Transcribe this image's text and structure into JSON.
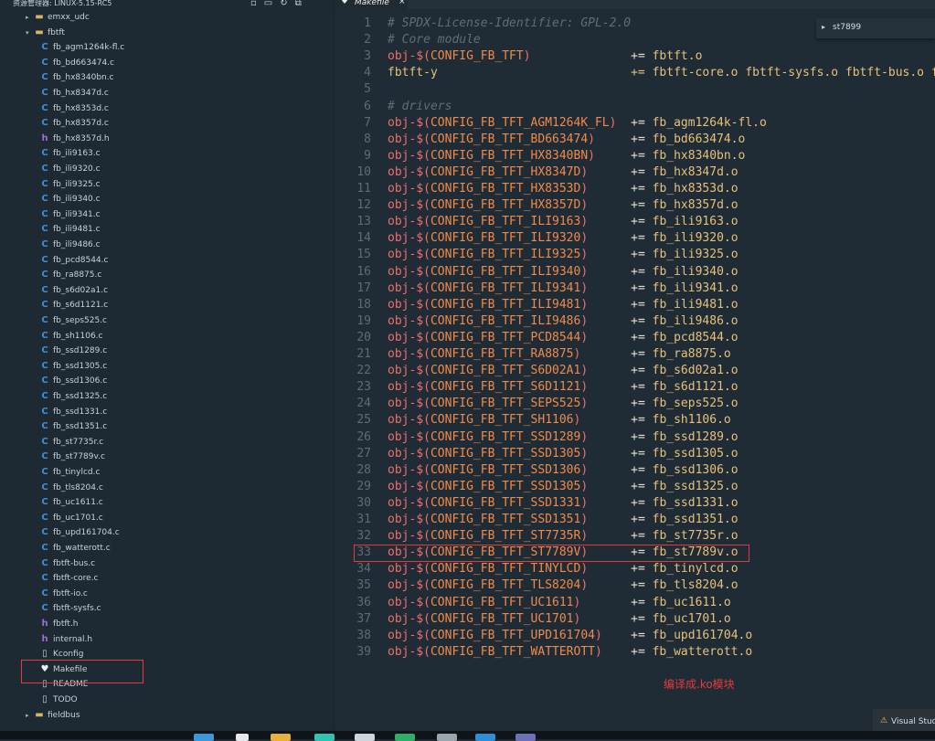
{
  "explorer": {
    "title": "资源管理器: LINUX-5.15-RC5",
    "items": [
      {
        "label": "emxx_udc",
        "type": "folder",
        "expanded": false
      },
      {
        "label": "fbtft",
        "type": "folder",
        "expanded": true
      },
      {
        "label": "fb_agm1264k-fl.c",
        "type": "c"
      },
      {
        "label": "fb_bd663474.c",
        "type": "c"
      },
      {
        "label": "fb_hx8340bn.c",
        "type": "c"
      },
      {
        "label": "fb_hx8347d.c",
        "type": "c"
      },
      {
        "label": "fb_hx8353d.c",
        "type": "c"
      },
      {
        "label": "fb_hx8357d.c",
        "type": "c"
      },
      {
        "label": "fb_hx8357d.h",
        "type": "h"
      },
      {
        "label": "fb_ili9163.c",
        "type": "c"
      },
      {
        "label": "fb_ili9320.c",
        "type": "c"
      },
      {
        "label": "fb_ili9325.c",
        "type": "c"
      },
      {
        "label": "fb_ili9340.c",
        "type": "c"
      },
      {
        "label": "fb_ili9341.c",
        "type": "c"
      },
      {
        "label": "fb_ili9481.c",
        "type": "c"
      },
      {
        "label": "fb_ili9486.c",
        "type": "c"
      },
      {
        "label": "fb_pcd8544.c",
        "type": "c"
      },
      {
        "label": "fb_ra8875.c",
        "type": "c"
      },
      {
        "label": "fb_s6d02a1.c",
        "type": "c"
      },
      {
        "label": "fb_s6d1121.c",
        "type": "c"
      },
      {
        "label": "fb_seps525.c",
        "type": "c"
      },
      {
        "label": "fb_sh1106.c",
        "type": "c"
      },
      {
        "label": "fb_ssd1289.c",
        "type": "c"
      },
      {
        "label": "fb_ssd1305.c",
        "type": "c"
      },
      {
        "label": "fb_ssd1306.c",
        "type": "c"
      },
      {
        "label": "fb_ssd1325.c",
        "type": "c"
      },
      {
        "label": "fb_ssd1331.c",
        "type": "c"
      },
      {
        "label": "fb_ssd1351.c",
        "type": "c"
      },
      {
        "label": "fb_st7735r.c",
        "type": "c"
      },
      {
        "label": "fb_st7789v.c",
        "type": "c"
      },
      {
        "label": "fb_tinylcd.c",
        "type": "c"
      },
      {
        "label": "fb_tls8204.c",
        "type": "c"
      },
      {
        "label": "fb_uc1611.c",
        "type": "c"
      },
      {
        "label": "fb_uc1701.c",
        "type": "c"
      },
      {
        "label": "fb_upd161704.c",
        "type": "c"
      },
      {
        "label": "fb_watterott.c",
        "type": "c"
      },
      {
        "label": "fbtft-bus.c",
        "type": "c"
      },
      {
        "label": "fbtft-core.c",
        "type": "c"
      },
      {
        "label": "fbtft-io.c",
        "type": "c"
      },
      {
        "label": "fbtft-sysfs.c",
        "type": "c"
      },
      {
        "label": "fbtft.h",
        "type": "h"
      },
      {
        "label": "internal.h",
        "type": "h"
      },
      {
        "label": "Kconfig",
        "type": "file"
      },
      {
        "label": "Makefile",
        "type": "make",
        "selected": true
      },
      {
        "label": "README",
        "type": "file"
      },
      {
        "label": "TODO",
        "type": "file"
      },
      {
        "label": "fieldbus",
        "type": "folder",
        "expanded": false
      }
    ]
  },
  "tab": {
    "label": "Makefile",
    "close": "×"
  },
  "find": {
    "query": "st7899"
  },
  "annotation": "编译成.ko模块",
  "notification": {
    "text": "Visual Stud"
  },
  "code": [
    {
      "n": "1",
      "kind": "comment",
      "text": "# SPDX-License-Identifier: GPL-2.0"
    },
    {
      "n": "2",
      "kind": "comment",
      "text": "# Core module"
    },
    {
      "n": "3",
      "kind": "obj",
      "macro": "CONFIG_FB_TFT",
      "pad": "            ",
      "val": "fbtft.o"
    },
    {
      "n": "4",
      "kind": "plain",
      "text": "fbtft-y                           += fbtft-core.o fbtft-sysfs.o fbtft-bus.o fbtft-io.o"
    },
    {
      "n": "5",
      "kind": "blank",
      "text": ""
    },
    {
      "n": "6",
      "kind": "comment",
      "text": "# drivers"
    },
    {
      "n": "7",
      "kind": "obj",
      "macro": "CONFIG_FB_TFT_AGM1264K_FL",
      "pad": "",
      "val": "fb_agm1264k-fl.o"
    },
    {
      "n": "8",
      "kind": "obj",
      "macro": "CONFIG_FB_TFT_BD663474",
      "pad": "   ",
      "val": "fb_bd663474.o"
    },
    {
      "n": "9",
      "kind": "obj",
      "macro": "CONFIG_FB_TFT_HX8340BN",
      "pad": "   ",
      "val": "fb_hx8340bn.o"
    },
    {
      "n": "10",
      "kind": "obj",
      "macro": "CONFIG_FB_TFT_HX8347D",
      "pad": "    ",
      "val": "fb_hx8347d.o"
    },
    {
      "n": "11",
      "kind": "obj",
      "macro": "CONFIG_FB_TFT_HX8353D",
      "pad": "    ",
      "val": "fb_hx8353d.o"
    },
    {
      "n": "12",
      "kind": "obj",
      "macro": "CONFIG_FB_TFT_HX8357D",
      "pad": "    ",
      "val": "fb_hx8357d.o"
    },
    {
      "n": "13",
      "kind": "obj",
      "macro": "CONFIG_FB_TFT_ILI9163",
      "pad": "    ",
      "val": "fb_ili9163.o"
    },
    {
      "n": "14",
      "kind": "obj",
      "macro": "CONFIG_FB_TFT_ILI9320",
      "pad": "    ",
      "val": "fb_ili9320.o"
    },
    {
      "n": "15",
      "kind": "obj",
      "macro": "CONFIG_FB_TFT_ILI9325",
      "pad": "    ",
      "val": "fb_ili9325.o"
    },
    {
      "n": "16",
      "kind": "obj",
      "macro": "CONFIG_FB_TFT_ILI9340",
      "pad": "    ",
      "val": "fb_ili9340.o"
    },
    {
      "n": "17",
      "kind": "obj",
      "macro": "CONFIG_FB_TFT_ILI9341",
      "pad": "    ",
      "val": "fb_ili9341.o"
    },
    {
      "n": "18",
      "kind": "obj",
      "macro": "CONFIG_FB_TFT_ILI9481",
      "pad": "    ",
      "val": "fb_ili9481.o"
    },
    {
      "n": "19",
      "kind": "obj",
      "macro": "CONFIG_FB_TFT_ILI9486",
      "pad": "    ",
      "val": "fb_ili9486.o"
    },
    {
      "n": "20",
      "kind": "obj",
      "macro": "CONFIG_FB_TFT_PCD8544",
      "pad": "    ",
      "val": "fb_pcd8544.o"
    },
    {
      "n": "21",
      "kind": "obj",
      "macro": "CONFIG_FB_TFT_RA8875",
      "pad": "     ",
      "val": "fb_ra8875.o"
    },
    {
      "n": "22",
      "kind": "obj",
      "macro": "CONFIG_FB_TFT_S6D02A1",
      "pad": "    ",
      "val": "fb_s6d02a1.o"
    },
    {
      "n": "23",
      "kind": "obj",
      "macro": "CONFIG_FB_TFT_S6D1121",
      "pad": "    ",
      "val": "fb_s6d1121.o"
    },
    {
      "n": "24",
      "kind": "obj",
      "macro": "CONFIG_FB_TFT_SEPS525",
      "pad": "    ",
      "val": "fb_seps525.o"
    },
    {
      "n": "25",
      "kind": "obj",
      "macro": "CONFIG_FB_TFT_SH1106",
      "pad": "     ",
      "val": "fb_sh1106.o"
    },
    {
      "n": "26",
      "kind": "obj",
      "macro": "CONFIG_FB_TFT_SSD1289",
      "pad": "    ",
      "val": "fb_ssd1289.o"
    },
    {
      "n": "27",
      "kind": "obj",
      "macro": "CONFIG_FB_TFT_SSD1305",
      "pad": "    ",
      "val": "fb_ssd1305.o"
    },
    {
      "n": "28",
      "kind": "obj",
      "macro": "CONFIG_FB_TFT_SSD1306",
      "pad": "    ",
      "val": "fb_ssd1306.o"
    },
    {
      "n": "29",
      "kind": "obj",
      "macro": "CONFIG_FB_TFT_SSD1305",
      "pad": "    ",
      "val": "fb_ssd1325.o"
    },
    {
      "n": "30",
      "kind": "obj",
      "macro": "CONFIG_FB_TFT_SSD1331",
      "pad": "    ",
      "val": "fb_ssd1331.o"
    },
    {
      "n": "31",
      "kind": "obj",
      "macro": "CONFIG_FB_TFT_SSD1351",
      "pad": "    ",
      "val": "fb_ssd1351.o"
    },
    {
      "n": "32",
      "kind": "obj",
      "macro": "CONFIG_FB_TFT_ST7735R",
      "pad": "    ",
      "val": "fb_st7735r.o"
    },
    {
      "n": "33",
      "kind": "obj",
      "macro": "CONFIG_FB_TFT_ST7789V",
      "pad": "    ",
      "val": "fb_st7789v.o"
    },
    {
      "n": "34",
      "kind": "obj",
      "macro": "CONFIG_FB_TFT_TINYLCD",
      "pad": "    ",
      "val": "fb_tinylcd.o"
    },
    {
      "n": "35",
      "kind": "obj",
      "macro": "CONFIG_FB_TFT_TLS8204",
      "pad": "    ",
      "val": "fb_tls8204.o"
    },
    {
      "n": "36",
      "kind": "obj",
      "macro": "CONFIG_FB_TFT_UC1611",
      "pad": "     ",
      "val": "fb_uc1611.o"
    },
    {
      "n": "37",
      "kind": "obj",
      "macro": "CONFIG_FB_TFT_UC1701",
      "pad": "     ",
      "val": "fb_uc1701.o"
    },
    {
      "n": "38",
      "kind": "obj",
      "macro": "CONFIG_FB_TFT_UPD161704",
      "pad": "  ",
      "val": "fb_upd161704.o"
    },
    {
      "n": "39",
      "kind": "obj",
      "macro": "CONFIG_FB_TFT_WATTEROTT",
      "pad": "  ",
      "val": "fb_watterott.o"
    }
  ],
  "colors": {
    "accent_red": "#e23c3c",
    "bg": "#202c35"
  }
}
